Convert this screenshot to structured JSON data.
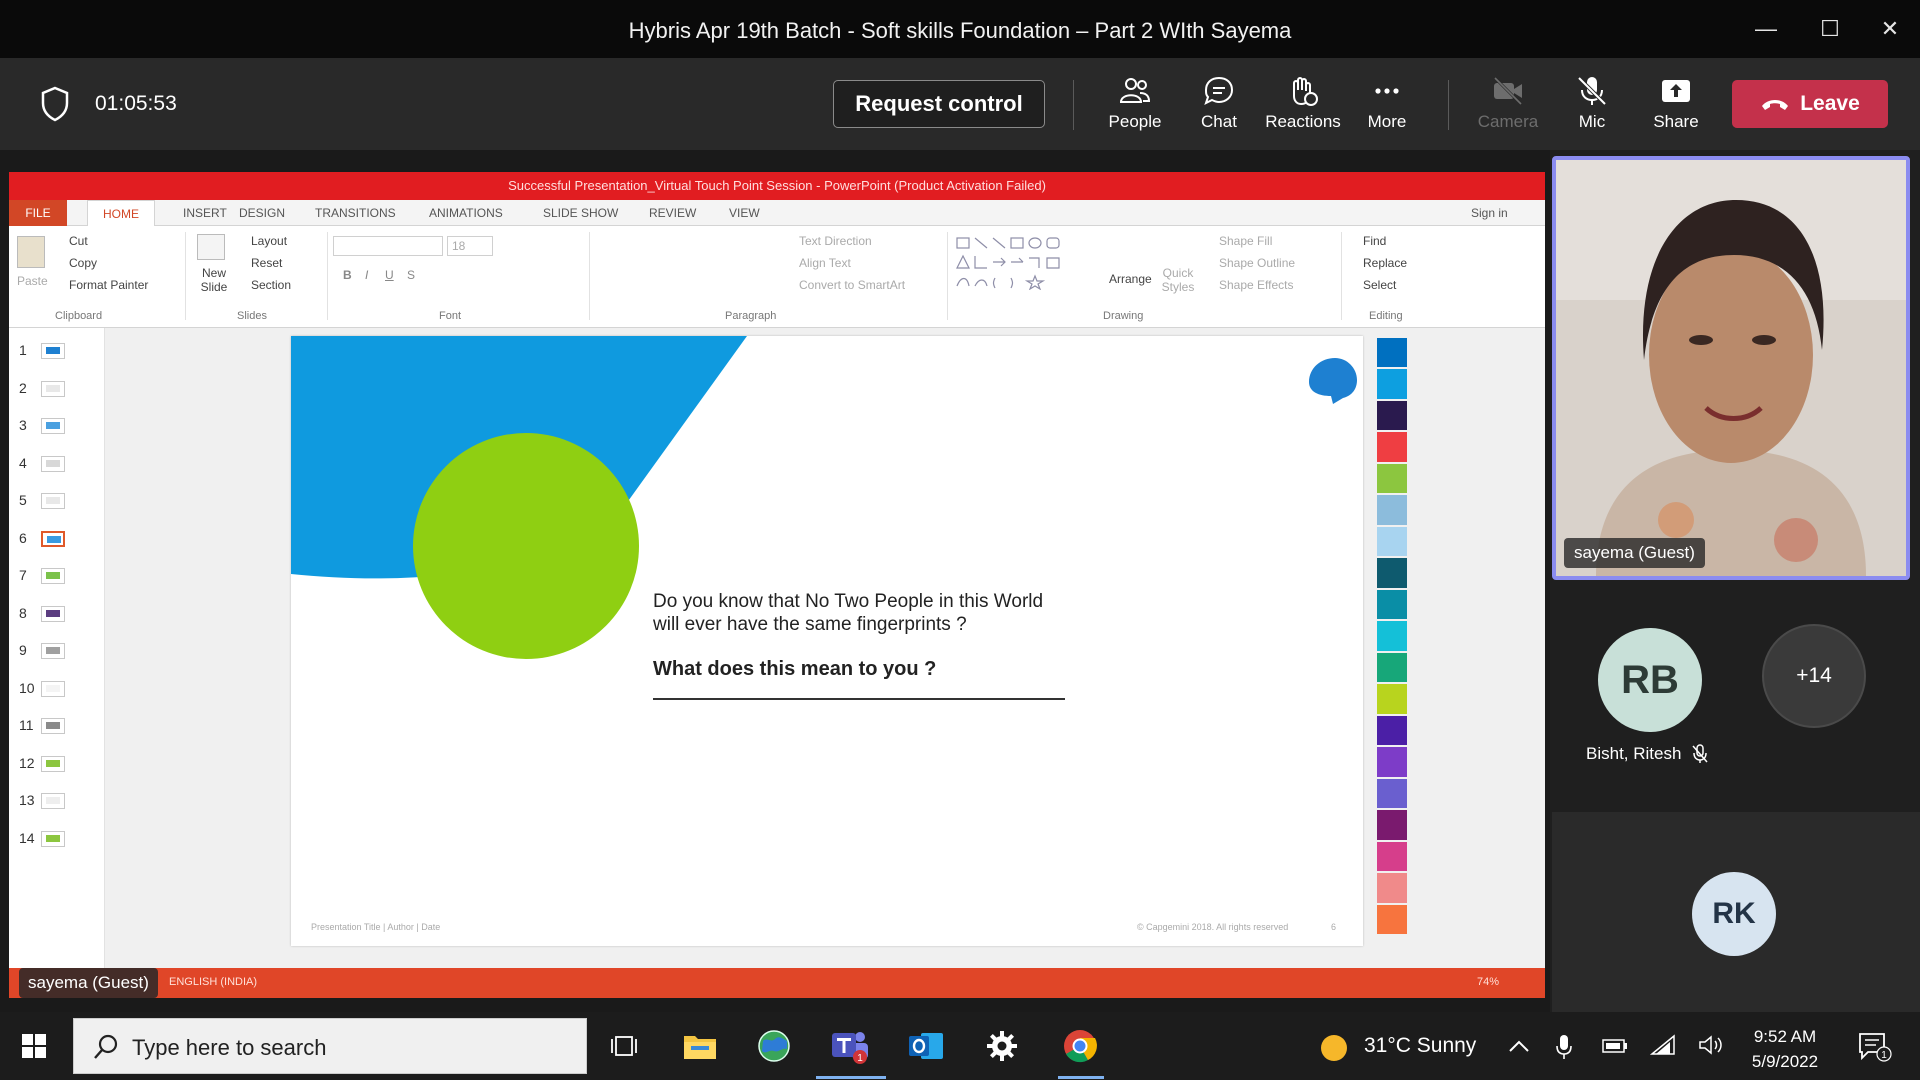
{
  "window": {
    "title": "Hybris Apr 19th Batch - Soft skills Foundation – Part 2 WIth Sayema",
    "controls": {
      "minimize": "—",
      "maximize": "☐",
      "close": "✕"
    }
  },
  "meeting": {
    "timer": "01:05:53",
    "request_control_label": "Request control",
    "tools": [
      {
        "label": "People",
        "icon": "people-icon"
      },
      {
        "label": "Chat",
        "icon": "chat-icon"
      },
      {
        "label": "Reactions",
        "icon": "reactions-icon"
      },
      {
        "label": "More",
        "icon": "more-icon"
      },
      {
        "label": "Camera",
        "icon": "camera-off-icon"
      },
      {
        "label": "Mic",
        "icon": "mic-off-icon"
      },
      {
        "label": "Share",
        "icon": "share-icon"
      }
    ],
    "leave_label": "Leave",
    "leave_color": "#c4314b",
    "presenter_chip": "sayema (Guest)"
  },
  "powerpoint": {
    "title": "Successful Presentation_Virtual Touch Point Session - PowerPoint (Product Activation Failed)",
    "tabs": [
      "FILE",
      "HOME",
      "INSERT",
      "DESIGN",
      "TRANSITIONS",
      "ANIMATIONS",
      "SLIDE SHOW",
      "REVIEW",
      "VIEW"
    ],
    "sign_in": "Sign in",
    "ribbon": {
      "clipboard": {
        "paste": "Paste",
        "cut": "Cut",
        "copy": "Copy",
        "format_painter": "Format Painter",
        "group": "Clipboard"
      },
      "slides": {
        "new_slide": "New Slide",
        "layout": "Layout",
        "reset": "Reset",
        "section": "Section",
        "group": "Slides"
      },
      "font": {
        "size": "18",
        "group": "Font"
      },
      "paragraph": {
        "text_direction": "Text Direction",
        "align_text": "Align Text",
        "convert": "Convert to SmartArt",
        "group": "Paragraph"
      },
      "drawing": {
        "arrange": "Arrange",
        "quick_styles": "Quick Styles",
        "shape_fill": "Shape Fill",
        "shape_outline": "Shape Outline",
        "shape_effects": "Shape Effects",
        "group": "Drawing"
      },
      "editing": {
        "find": "Find",
        "replace": "Replace",
        "select": "Select",
        "group": "Editing"
      }
    },
    "slide_numbers": [
      "1",
      "2",
      "3",
      "4",
      "5",
      "6",
      "7",
      "8",
      "9",
      "10",
      "11",
      "12",
      "13",
      "14"
    ],
    "selected_slide": 6,
    "slide": {
      "question_line1": "Do you know that No Two People in this World",
      "question_line2": "will ever have the same fingerprints ?",
      "prompt": "What does this mean to you ?",
      "footer_left": "Presentation Title | Author | Date",
      "footer_right": "© Capgemini 2018. All rights reserved",
      "footer_page": "6",
      "palette": [
        "#0070c0",
        "#0d9fe0",
        "#2a1a4e",
        "#ef3e42",
        "#8cc63f",
        "#8cbcdc",
        "#a8d4f0",
        "#0e5a6e",
        "#0a8ea6",
        "#14c0d8",
        "#17a779",
        "#b8d41e",
        "#4b1fa6",
        "#7d3cc8",
        "#6a5fcf",
        "#7a1a6e",
        "#d63e8b",
        "#f08a8a",
        "#f7743e"
      ]
    },
    "status_text": "ENGLISH (INDIA)",
    "zoom": "74%"
  },
  "participants": {
    "video_label": "sayema (Guest)",
    "rb": {
      "initials": "RB",
      "name": "Bisht, Ritesh"
    },
    "more_count": "+14",
    "rk": {
      "initials": "RK"
    }
  },
  "taskbar": {
    "search_placeholder": "Type here to search",
    "weather": "31°C  Sunny",
    "time": "9:52 AM",
    "date": "5/9/2022",
    "teams_badge": "1",
    "notification_badge": "1"
  }
}
